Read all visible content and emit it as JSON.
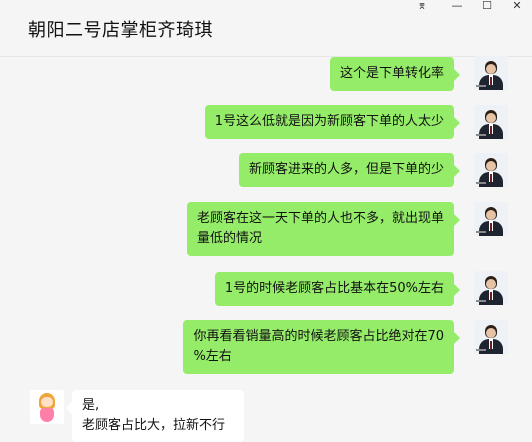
{
  "window": {
    "title": "朝阳二号店掌柜齐琦琪",
    "pin_glyph": "⌆",
    "minimize_glyph": "—",
    "maximize_glyph": "☐",
    "close_glyph": "✕"
  },
  "messages": [
    {
      "sender": "me",
      "text": "这个是下单转化率"
    },
    {
      "sender": "me",
      "text": "1号这么低就是因为新顾客下单的人太少"
    },
    {
      "sender": "me",
      "text": "新顾客进来的人多，但是下单的少"
    },
    {
      "sender": "me",
      "lines": [
        "老顾客在这一天下单的人也不多，就出现单",
        "量低的情况"
      ]
    },
    {
      "sender": "me",
      "text": "1号的时候老顾客占比基本在50%左右"
    },
    {
      "sender": "me",
      "lines": [
        "你再看看销量高的时候老顾客占比绝对在70",
        "%左右"
      ]
    },
    {
      "sender": "other",
      "lines": [
        "是,",
        "老顾客占比大，拉新不行"
      ]
    }
  ],
  "colors": {
    "outgoing_bubble": "#95ec69",
    "incoming_bubble": "#ffffff",
    "background": "#f5f5f5"
  }
}
